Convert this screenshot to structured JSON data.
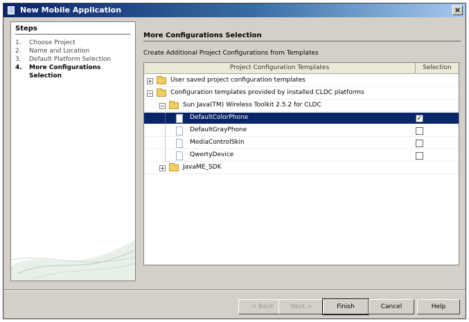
{
  "window": {
    "title": "New Mobile Application",
    "close_glyph": "×"
  },
  "steps": {
    "title": "Steps",
    "items": [
      {
        "num": "1.",
        "label": "Choose Project",
        "current": false
      },
      {
        "num": "2.",
        "label": "Name and Location",
        "current": false
      },
      {
        "num": "3.",
        "label": "Default Platform Selection",
        "current": false
      },
      {
        "num": "4.",
        "label": "More Configurations Selection",
        "current": true
      }
    ]
  },
  "main": {
    "title": "More Configurations Selection",
    "create_label": "Create Additional Project Configurations from Templates",
    "columns": {
      "templates": "Project Configuration Templates",
      "selection": "Selection"
    },
    "rows": [
      {
        "label": "User saved project configuration templates",
        "type": "folder",
        "expander": "+",
        "checkbox": null
      },
      {
        "label": "Configuration templates provided by installed CLDC platforms",
        "type": "folder",
        "expander": "−",
        "checkbox": null
      },
      {
        "label": "Sun Java(TM) Wireless Toolkit 2.5.2 for CLDC",
        "type": "folder",
        "expander": "−",
        "checkbox": null
      },
      {
        "label": "DefaultColorPhone",
        "type": "file",
        "checkbox": true,
        "selected": true
      },
      {
        "label": "DefaultGrayPhone",
        "type": "file",
        "checkbox": false
      },
      {
        "label": "MediaControlSkin",
        "type": "file",
        "checkbox": false
      },
      {
        "label": "QwertyDevice",
        "type": "file",
        "checkbox": false
      },
      {
        "label": "JavaME_SDK",
        "type": "folder",
        "expander": "+",
        "checkbox": null
      }
    ]
  },
  "buttons": {
    "back": "< Back",
    "next": "Next >",
    "finish": "Finish",
    "cancel": "Cancel",
    "help": "Help"
  },
  "icons": {
    "app": "mobile-app-icon",
    "folder": "folder-icon",
    "file": "file-icon",
    "checkbox": "checkbox-icon"
  },
  "colors": {
    "title_bar": "#0a246a",
    "selection": "#0a246a",
    "dialog_bg": "#d4d0c8"
  }
}
